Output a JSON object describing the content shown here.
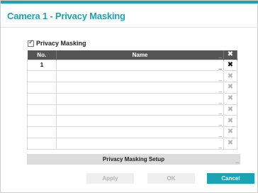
{
  "dialog": {
    "title": "Camera 1 - Privacy Masking",
    "accent_color": "#1ba3b3"
  },
  "privacy_masking": {
    "label": "Privacy Masking",
    "checked": true,
    "checkmark": "☑"
  },
  "table": {
    "headers": {
      "no": "No.",
      "name": "Name",
      "delete_icon": "close-icon"
    },
    "rows": [
      {
        "no": "1",
        "name": "",
        "delete_enabled": true
      },
      {
        "no": "",
        "name": "",
        "delete_enabled": false
      },
      {
        "no": "",
        "name": "",
        "delete_enabled": false
      },
      {
        "no": "",
        "name": "",
        "delete_enabled": false
      },
      {
        "no": "",
        "name": "",
        "delete_enabled": false
      },
      {
        "no": "",
        "name": "",
        "delete_enabled": false
      },
      {
        "no": "",
        "name": "",
        "delete_enabled": false
      },
      {
        "no": "",
        "name": "",
        "delete_enabled": false
      }
    ]
  },
  "setup_button": {
    "label": "Privacy Masking Setup"
  },
  "footer": {
    "apply_label": "Apply",
    "ok_label": "OK",
    "cancel_label": "Cancel"
  }
}
